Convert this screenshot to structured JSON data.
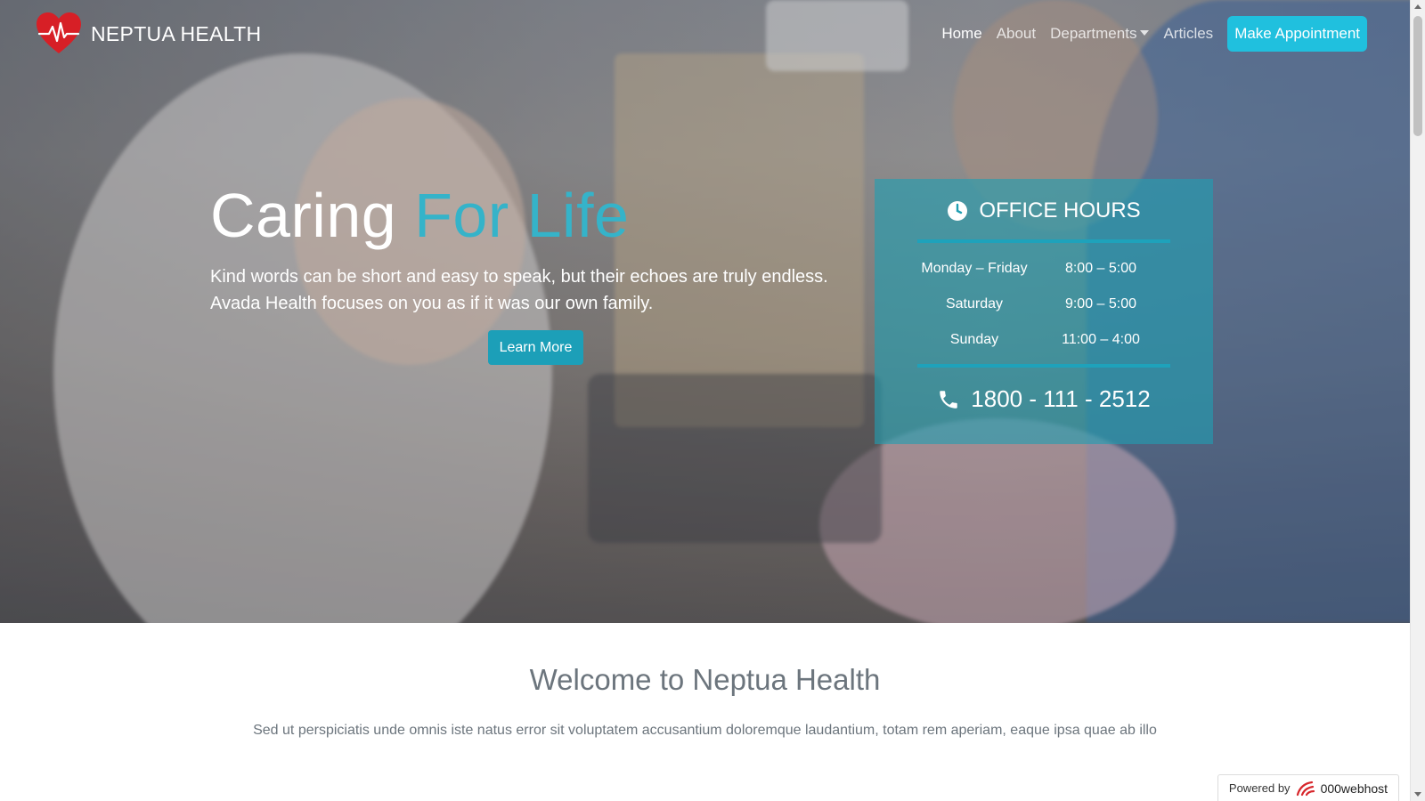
{
  "brand": {
    "name": "NEPTUA HEALTH",
    "icon": "heart-pulse-icon"
  },
  "nav": {
    "items": [
      "Home",
      "About",
      "Departments",
      "Articles"
    ],
    "active": "Home",
    "cta": "Make Appointment"
  },
  "hero": {
    "title_main": "Caring ",
    "title_accent": "For Life",
    "subtitle_line1": "Kind words can be short and easy to speak, but their echoes are truly endless.",
    "subtitle_line2": "Avada Health focuses on you as if it was our own family.",
    "button": "Learn More"
  },
  "office_hours": {
    "title": "OFFICE HOURS",
    "rows": [
      {
        "day": "Monday – Friday",
        "time": "8:00 – 5:00"
      },
      {
        "day": "Saturday",
        "time": "9:00 – 5:00"
      },
      {
        "day": "Sunday",
        "time": "11:00 – 4:00"
      }
    ],
    "phone": "1800 - 111 - 2512"
  },
  "welcome": {
    "title": "Welcome to Neptua Health",
    "text": "Sed ut perspiciatis unde omnis iste natus error sit voluptatem accusantium doloremque laudantium, totam rem aperiam, eaque ipsa quae ab illo"
  },
  "powered": {
    "prefix": "Powered by",
    "brand": "000webhost"
  },
  "colors": {
    "accent": "#35b3c9",
    "cta": "#20c0de",
    "button": "#1c9fb8",
    "card": "#209eb2",
    "muted_text": "#6c757d"
  }
}
